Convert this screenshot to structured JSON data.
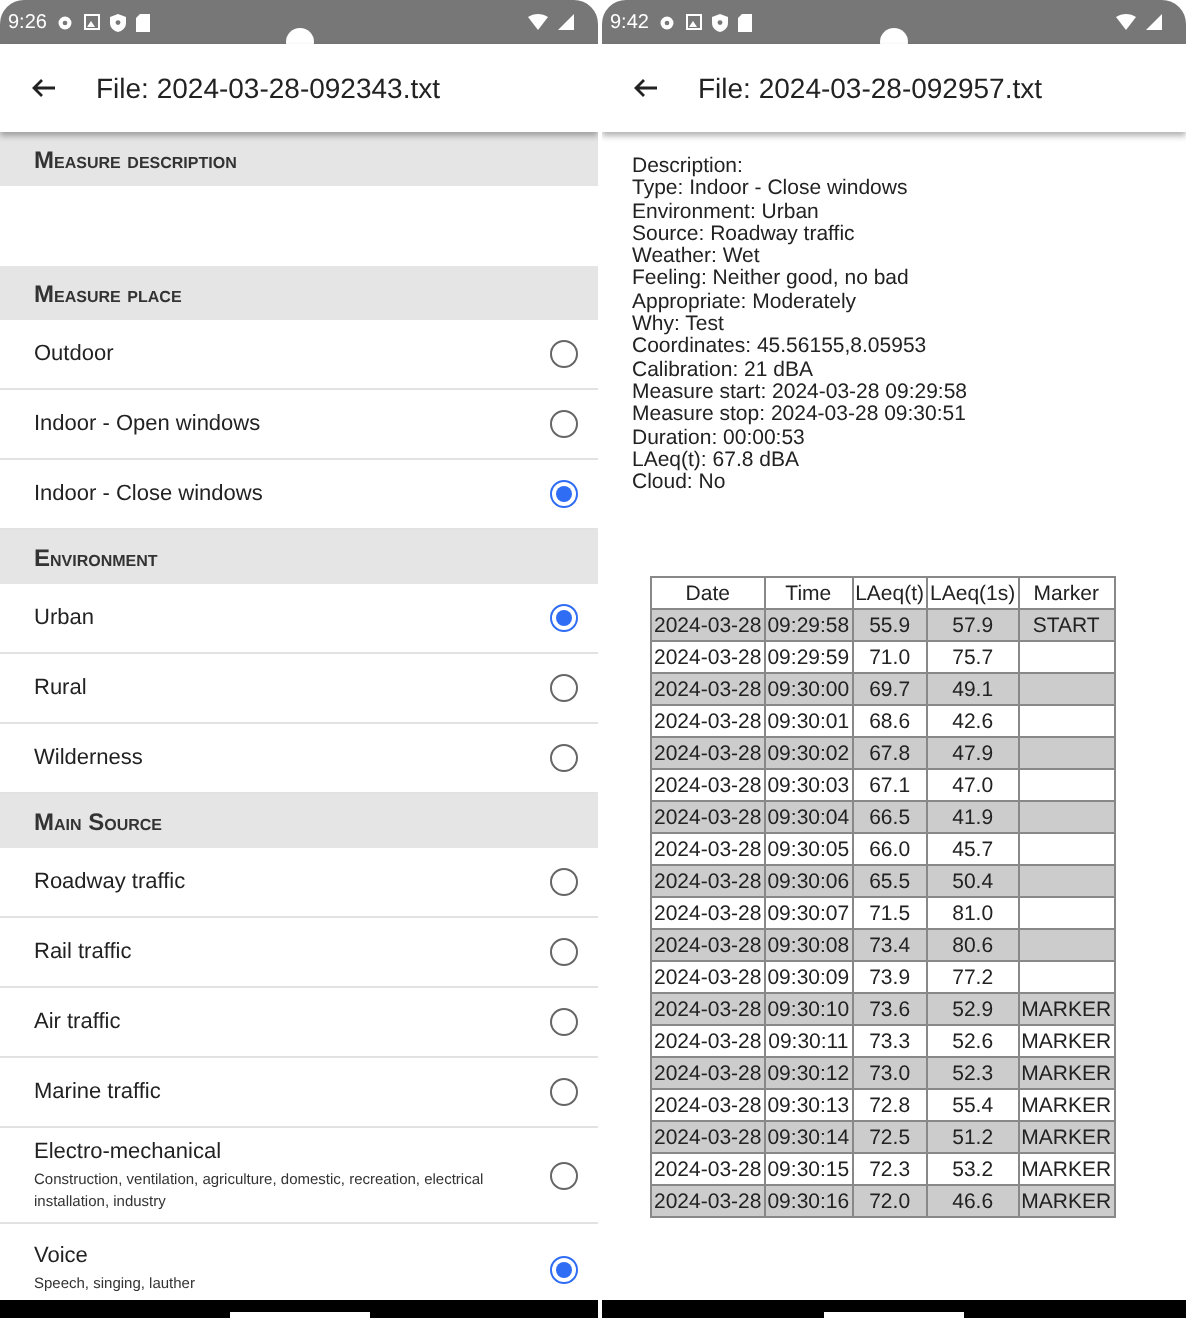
{
  "form_screen": {
    "status_bar": {
      "time": "9:26"
    },
    "app_bar": {
      "title": "File: 2024-03-28-092343.txt"
    },
    "sections": [
      {
        "title": "Measure description"
      },
      {
        "title": "Measure place",
        "options": [
          {
            "label": "Outdoor",
            "selected": false
          },
          {
            "label": "Indoor - Open windows",
            "selected": false
          },
          {
            "label": "Indoor - Close windows",
            "selected": true
          }
        ]
      },
      {
        "title": "Environment",
        "options": [
          {
            "label": "Urban",
            "selected": true
          },
          {
            "label": "Rural",
            "selected": false
          },
          {
            "label": "Wilderness",
            "selected": false
          }
        ]
      },
      {
        "title": "Main Source",
        "options": [
          {
            "label": "Roadway traffic",
            "selected": false
          },
          {
            "label": "Rail traffic",
            "selected": false
          },
          {
            "label": "Air traffic",
            "selected": false
          },
          {
            "label": "Marine traffic",
            "selected": false
          },
          {
            "label": "Electro-mechanical",
            "sublabel": "Construction, ventilation, agriculture, domestic, recreation, electrical installation, industry",
            "selected": false
          },
          {
            "label": "Voice",
            "sublabel": "Speech, singing, lauther",
            "selected": true
          }
        ]
      }
    ]
  },
  "file_screen": {
    "status_bar": {
      "time": "9:42"
    },
    "app_bar": {
      "title": "File: 2024-03-28-092957.txt"
    },
    "description": [
      "Description:",
      "Type: Indoor - Close windows",
      "Environment: Urban",
      "Source: Roadway traffic",
      "Weather: Wet",
      "Feeling: Neither good, no bad",
      "Appropriate: Moderately",
      "Why: Test",
      "Coordinates: 45.56155,8.05953",
      "Calibration: 21 dBA",
      "Measure start: 2024-03-28 09:29:58",
      "Measure stop: 2024-03-28 09:30:51",
      "Duration: 00:00:53",
      "LAeq(t): 67.8 dBA",
      "Cloud: No"
    ],
    "table": {
      "columns": [
        "Date",
        "Time",
        "LAeq(t)",
        "LAeq(1s)",
        "Marker"
      ],
      "rows": [
        [
          "2024-03-28",
          "09:29:58",
          "55.9",
          "57.9",
          "START"
        ],
        [
          "2024-03-28",
          "09:29:59",
          "71.0",
          "75.7"
        ],
        [
          "2024-03-28",
          "09:30:00",
          "69.7",
          "49.1"
        ],
        [
          "2024-03-28",
          "09:30:01",
          "68.6",
          "42.6"
        ],
        [
          "2024-03-28",
          "09:30:02",
          "67.8",
          "47.9"
        ],
        [
          "2024-03-28",
          "09:30:03",
          "67.1",
          "47.0"
        ],
        [
          "2024-03-28",
          "09:30:04",
          "66.5",
          "41.9"
        ],
        [
          "2024-03-28",
          "09:30:05",
          "66.0",
          "45.7"
        ],
        [
          "2024-03-28",
          "09:30:06",
          "65.5",
          "50.4"
        ],
        [
          "2024-03-28",
          "09:30:07",
          "71.5",
          "81.0"
        ],
        [
          "2024-03-28",
          "09:30:08",
          "73.4",
          "80.6"
        ],
        [
          "2024-03-28",
          "09:30:09",
          "73.9",
          "77.2"
        ],
        [
          "2024-03-28",
          "09:30:10",
          "73.6",
          "52.9",
          "MARKER"
        ],
        [
          "2024-03-28",
          "09:30:11",
          "73.3",
          "52.6",
          "MARKER"
        ],
        [
          "2024-03-28",
          "09:30:12",
          "73.0",
          "52.3",
          "MARKER"
        ],
        [
          "2024-03-28",
          "09:30:13",
          "72.8",
          "55.4",
          "MARKER"
        ],
        [
          "2024-03-28",
          "09:30:14",
          "72.5",
          "51.2",
          "MARKER"
        ],
        [
          "2024-03-28",
          "09:30:15",
          "72.3",
          "53.2",
          "MARKER"
        ],
        [
          "2024-03-28",
          "09:30:16",
          "72.0",
          "46.6",
          "MARKER"
        ]
      ]
    }
  }
}
